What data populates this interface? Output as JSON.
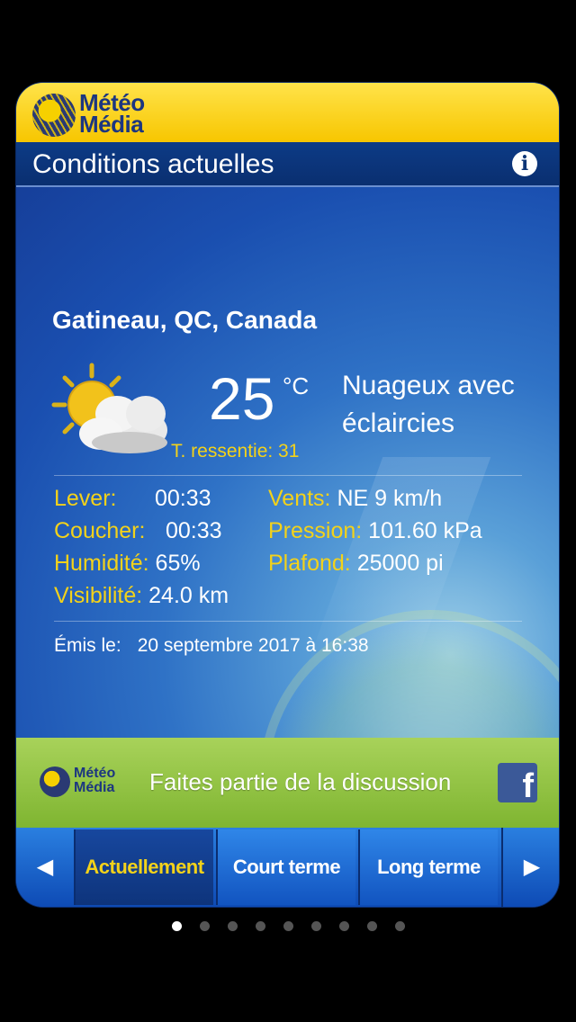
{
  "header": {
    "brand_line1": "Météo",
    "brand_line2": "Média"
  },
  "title": "Conditions actuelles",
  "location": "Gatineau, QC, Canada",
  "current": {
    "temperature": "25",
    "unit": "°C",
    "feels_like": "T. ressentie: 31",
    "condition": "Nuageux avec éclaircies",
    "icon": "partly-cloudy-icon"
  },
  "details": {
    "lever_label": "Lever:",
    "lever_value": "00:33",
    "coucher_label": "Coucher:",
    "coucher_value": "00:33",
    "humidite_label": "Humidité:",
    "humidite_value": "65%",
    "visibilite_label": "Visibilité:",
    "visibilite_value": "24.0 km",
    "vents_label": "Vents:",
    "vents_value": "NE 9 km/h",
    "pression_label": "Pression:",
    "pression_value": "101.60 kPa",
    "plafond_label": "Plafond:",
    "plafond_value": "25000 pi"
  },
  "issued": {
    "label": "Émis le:",
    "value": "20 septembre 2017 à 16:38"
  },
  "banner": {
    "brand_line1": "Météo",
    "brand_line2": "Média",
    "text": "Faites partie de la discussion",
    "fb_icon": "facebook-icon"
  },
  "nav": {
    "tabs": [
      "Actuellement",
      "Court terme",
      "Long terme"
    ],
    "active_index": 0
  },
  "pager": {
    "count": 9,
    "current": 1
  },
  "colors": {
    "accent_yellow": "#f3d21a",
    "brand_yellow": "#f7c600",
    "nav_blue": "#1254c0",
    "banner_green": "#8cc040"
  }
}
